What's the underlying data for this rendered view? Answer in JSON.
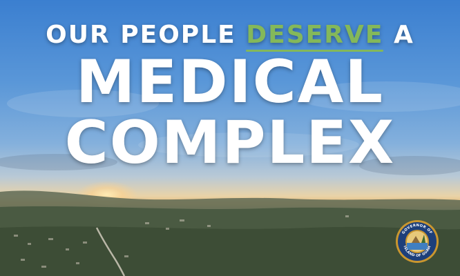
{
  "headline": {
    "line1_before": "OUR PEOPLE ",
    "line1_accent": "DESERVE",
    "line1_after": " A",
    "line2": "MEDICAL",
    "line3": "COMPLEX"
  },
  "seal": {
    "text_top": "GOVERNOR OF",
    "text_bottom": "ISLAND OF GUAM",
    "icon": "guam-governor-seal-icon"
  },
  "colors": {
    "accent": "#84b85a",
    "headline": "#ffffff",
    "seal_ring": "#c9962f"
  }
}
